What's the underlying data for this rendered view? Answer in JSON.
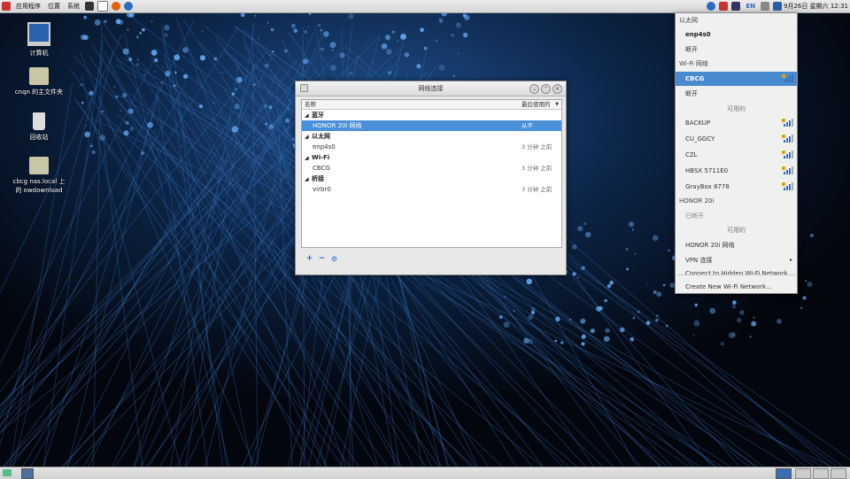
{
  "top_panel": {
    "menus": [
      "应用程序",
      "位置",
      "系统"
    ],
    "keyboard": "EN",
    "clock": "9月26日 星期六 12:31"
  },
  "desktop": {
    "icons": [
      {
        "label": "计算机",
        "icon": "computer-icon"
      },
      {
        "label": "cnqn 的主文件夹",
        "icon": "home-folder-icon"
      },
      {
        "label": "回收站",
        "icon": "trash-icon"
      },
      {
        "label": "cbcg nas.local 上的 owdownload",
        "icon": "network-folder-icon"
      }
    ]
  },
  "window": {
    "title": "网络连接",
    "header_name": "名称",
    "header_used": "最后使用的",
    "groups": [
      {
        "label": "蓝牙",
        "rows": [
          {
            "name": "HONOR 20i 网络",
            "time": "从不",
            "selected": true
          }
        ]
      },
      {
        "label": "以太网",
        "rows": [
          {
            "name": "enp4s0",
            "time": "3 分钟 之前"
          }
        ]
      },
      {
        "label": "Wi-Fi",
        "rows": [
          {
            "name": "CBCG",
            "time": "3 分钟 之前"
          }
        ]
      },
      {
        "label": "桥接",
        "rows": [
          {
            "name": "virbr0",
            "time": "3 分钟 之前"
          }
        ]
      }
    ],
    "toolbar": {
      "add": "+",
      "remove": "−",
      "edit": "⚙"
    }
  },
  "network_menu": {
    "items": [
      {
        "label": "以太网",
        "kind": "hdr"
      },
      {
        "label": "enp4s0",
        "kind": "bold"
      },
      {
        "label": "断开",
        "kind": "plain"
      },
      {
        "label": "Wi-Fi 网络",
        "kind": "hdr"
      },
      {
        "label": "CBCG",
        "kind": "sel",
        "signal": 4
      },
      {
        "label": "断开",
        "kind": "plain"
      },
      {
        "label": "可用的",
        "kind": "center"
      },
      {
        "label": "BACKUP",
        "kind": "plain",
        "signal": 3,
        "lock": true
      },
      {
        "label": "CU_GGCY",
        "kind": "plain",
        "signal": 3,
        "lock": true
      },
      {
        "label": "CZL",
        "kind": "plain",
        "signal": 3,
        "lock": true
      },
      {
        "label": "HBSX 5711E0",
        "kind": "plain",
        "signal": 3,
        "lock": true
      },
      {
        "label": "GrayBox 8778",
        "kind": "plain",
        "signal": 3,
        "lock": true
      },
      {
        "label": "HONOR 20i",
        "kind": "hdr"
      },
      {
        "label": "已断开",
        "kind": "dim"
      },
      {
        "label": "可用的",
        "kind": "center"
      },
      {
        "label": "HONOR 20i 网络",
        "kind": "plain"
      },
      {
        "label": "VPN 连接",
        "kind": "plain",
        "submenu": true
      },
      {
        "label": "Connect to Hidden Wi-Fi Network...",
        "kind": "plain"
      },
      {
        "label": "Create New Wi-Fi Network...",
        "kind": "plain"
      }
    ]
  },
  "colors": {
    "selection": "#4a90d9",
    "accent": "#3b6fb5"
  }
}
